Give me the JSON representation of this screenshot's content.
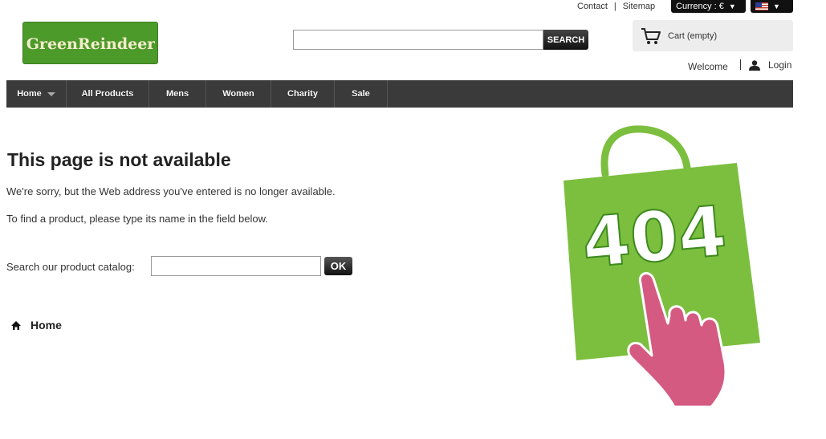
{
  "util": {
    "contact": "Contact",
    "separator": "|",
    "sitemap": "Sitemap"
  },
  "currency": {
    "label": "Currency : €",
    "arrow": "▼"
  },
  "language": {
    "selected_icon": "us-flag-icon",
    "arrow": "▼"
  },
  "logo": {
    "text": "GreenReindeer"
  },
  "search": {
    "value": "",
    "placeholder": "",
    "button_label": "SEARCH"
  },
  "cart": {
    "label": "Cart (empty)",
    "icon": "cart-icon"
  },
  "user": {
    "welcome": "Welcome",
    "login": "Login"
  },
  "nav": {
    "items": [
      {
        "label": "Home",
        "has_dropdown": true
      },
      {
        "label": "All Products"
      },
      {
        "label": "Mens"
      },
      {
        "label": "Women"
      },
      {
        "label": "Charity"
      },
      {
        "label": "Sale"
      }
    ]
  },
  "error": {
    "title": "This page is not available",
    "message1": "We're sorry, but the Web address you've entered is no longer available.",
    "message2": "To find a product, please type its name in the field below.",
    "catalog_label": "Search our product catalog:",
    "catalog_value": "",
    "ok_label": "OK",
    "home_label": "Home",
    "illustration_text": "404"
  },
  "colors": {
    "nav_bg": "#3a3a3a",
    "logo_green": "#4c9a2a",
    "bag_green": "#7cbf3f",
    "hand_pink": "#d45a82"
  }
}
